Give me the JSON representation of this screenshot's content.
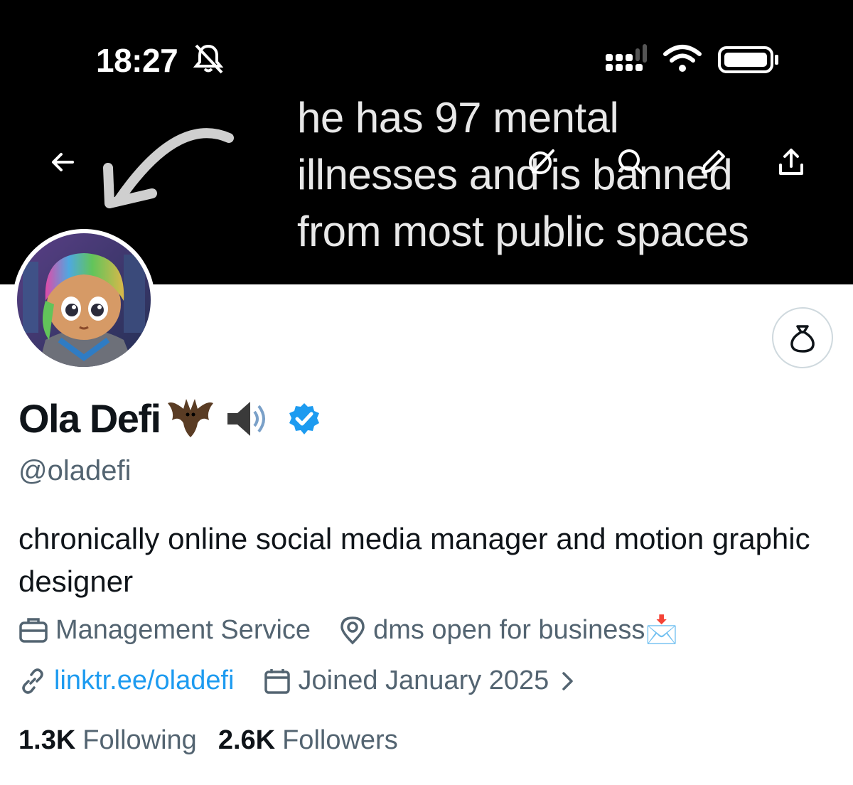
{
  "status_bar": {
    "time": "18:27",
    "icons": [
      "bell-muted-icon",
      "signal-icon",
      "wifi-icon",
      "battery-icon"
    ]
  },
  "banner": {
    "lines": [
      "he has 97 mental",
      "illnesses and is banned",
      "from most public spaces"
    ]
  },
  "nav": {
    "icons": [
      "back-arrow-icon",
      "grok-icon",
      "search-icon",
      "edit-icon",
      "share-icon"
    ]
  },
  "profile": {
    "name": "Ola Defi",
    "name_emojis": "🦇🔊",
    "handle": "@oladefi",
    "bio": "chronically online social media manager and motion graphic designer",
    "category": "Management Service",
    "location": "dms open for business📩",
    "link": "linktr.ee/oladefi",
    "joined": "Joined January 2025",
    "verified_color": "#1d9bf0"
  },
  "stats": {
    "following_count": "1.3K",
    "following_label": "Following",
    "followers_count": "2.6K",
    "followers_label": "Followers"
  }
}
